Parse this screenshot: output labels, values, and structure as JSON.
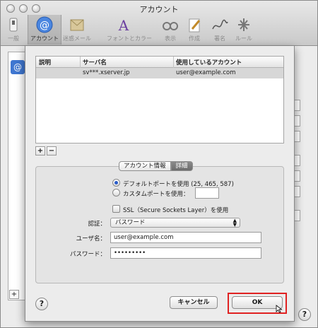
{
  "window": {
    "title": "アカウント"
  },
  "toolbar": {
    "items": [
      {
        "label": "一般",
        "icon": "general-switch-icon"
      },
      {
        "label": "アカウント",
        "icon": "at-sign-icon"
      },
      {
        "label": "迷惑メール",
        "icon": "junk-mail-icon"
      },
      {
        "label": "フォントとカラー",
        "icon": "fonts-colors-icon"
      },
      {
        "label": "表示",
        "icon": "viewing-glasses-icon"
      },
      {
        "label": "作成",
        "icon": "composing-pencil-icon"
      },
      {
        "label": "署名",
        "icon": "signature-icon"
      },
      {
        "label": "ルール",
        "icon": "rules-icon"
      }
    ]
  },
  "sheet": {
    "table": {
      "headers": [
        "説明",
        "サーバ名",
        "使用しているアカウント"
      ],
      "rows": [
        {
          "description": "",
          "server": "sv***.xserver.jp",
          "account": "user@example.com"
        }
      ]
    },
    "add_button": "+",
    "remove_button": "−",
    "tabs": [
      "アカウント情報",
      "詳細"
    ],
    "default_port_label": "デフォルトポートを使用 (25, 465, 587)",
    "custom_port_label": "カスタムポートを使用：",
    "custom_port_value": "",
    "ssl_label": "SSL（Secure Sockets Layer）を使用",
    "auth_label": "認証：",
    "auth_value": "パスワード",
    "username_label": "ユーザ名：",
    "username_value": "user@example.com",
    "password_label": "パスワード：",
    "password_value": "•••••••••",
    "help": "?",
    "cancel_label": "キャンセル",
    "ok_label": "OK"
  },
  "background": {
    "add_button": "+",
    "help": "?"
  }
}
